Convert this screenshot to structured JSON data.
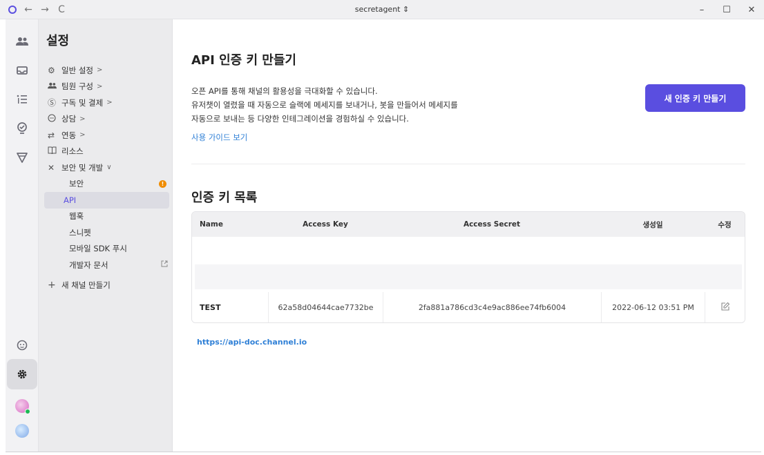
{
  "titlebar": {
    "title": "secretagent ⇕",
    "back_icon": "←",
    "forward_icon": "→",
    "reload_icon": "C",
    "minimize": "–",
    "maximize": "☐",
    "close": "✕"
  },
  "rail": {
    "icons": [
      "team-icon",
      "inbox-icon",
      "list-icon",
      "marketing-icon",
      "send-icon",
      "status-icon",
      "settings-icon"
    ]
  },
  "sidebar": {
    "title": "설정",
    "items": [
      {
        "label": "일반 설정",
        "chevron": ">"
      },
      {
        "label": "팀원 구성",
        "chevron": ">"
      },
      {
        "label": "구독 및 결제",
        "chevron": ">"
      },
      {
        "label": "상담",
        "chevron": ">"
      },
      {
        "label": "연동",
        "chevron": ">"
      },
      {
        "label": "리소스",
        "chevron": ""
      },
      {
        "label": "보안 및 개발",
        "chevron": "∨"
      }
    ],
    "sub_items": [
      {
        "label": "보안",
        "badge": "!"
      },
      {
        "label": "API"
      },
      {
        "label": "웹훅"
      },
      {
        "label": "스니펫"
      },
      {
        "label": "모바일 SDK 푸시"
      },
      {
        "label": "개발자 문서"
      }
    ],
    "new_channel": "새 채널 만들기"
  },
  "main": {
    "heading": "API 인증 키 만들기",
    "description_lines": [
      "오픈 API를 통해 채널의 활용성을 극대화할 수 있습니다.",
      "유저챗이 열렸을 때 자동으로 슬랙에 메세지를 보내거나, 봇을 만들어서 메세지를",
      "자동으로 보내는 등 다양한 인테그레이션을 경험하실 수 있습니다."
    ],
    "guide_link": "사용 가이드 보기",
    "create_button": "새 인증 키 만들기",
    "list_heading": "인증 키 목록",
    "table": {
      "headers": [
        "Name",
        "Access Key",
        "Access Secret",
        "생성일",
        "수정"
      ],
      "rows": [
        {
          "name": "TEST",
          "access_key": "62a58d04644cae7732be",
          "access_secret": "2fa881a786cd3c4e9ac886ee74fb6004",
          "created": "2022-06-12 03:51 PM"
        }
      ]
    },
    "doc_link": "https://api-doc.channel.io"
  },
  "colors": {
    "accent": "#5a4ee0",
    "link": "#2e7fd6",
    "warning": "#f08c00"
  }
}
